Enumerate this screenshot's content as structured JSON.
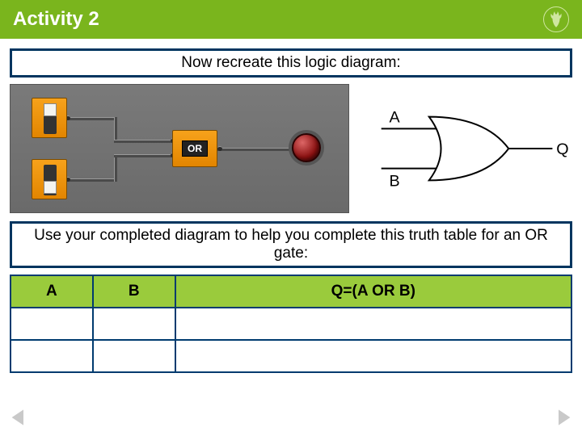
{
  "header": {
    "title": "Activity 2",
    "logo_name": "stag-head-icon"
  },
  "instruction1": "Now recreate this logic diagram:",
  "sim": {
    "gate_label": "OR",
    "input_a_name": "switch-a",
    "input_b_name": "switch-b",
    "output_name": "lamp-output"
  },
  "symbol": {
    "input_a": "A",
    "input_b": "B",
    "output": "Q"
  },
  "instruction2": "Use your completed diagram to help you complete this truth table for an OR gate:",
  "truth_table": {
    "headers": [
      "A",
      "B",
      "Q=(A OR B)"
    ],
    "rows": [
      [
        "",
        "",
        ""
      ],
      [
        "",
        "",
        ""
      ]
    ]
  },
  "nav": {
    "prev": "previous-slide",
    "next": "next-slide"
  }
}
